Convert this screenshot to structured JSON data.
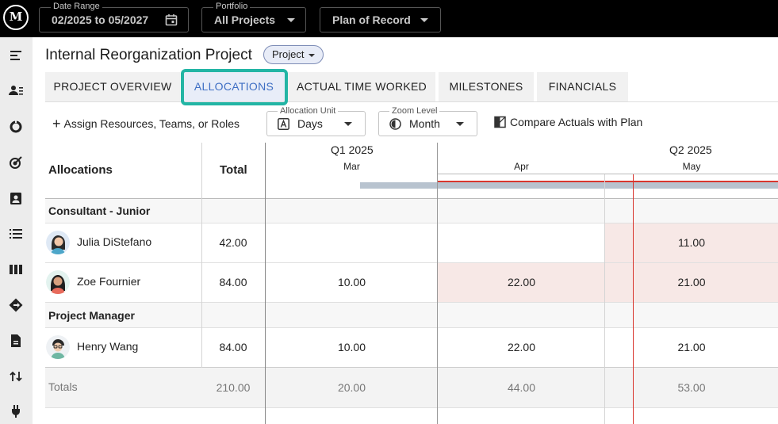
{
  "topbar": {
    "logo_text": "M",
    "date_range": {
      "label": "Date Range",
      "value": "02/2025 to 05/2027"
    },
    "portfolio": {
      "label": "Portfolio",
      "value": "All Projects"
    },
    "plan": {
      "value": "Plan of Record"
    }
  },
  "rail": {
    "icons": [
      "menu-collapse-icon",
      "people-list-icon",
      "donut-chart-icon",
      "target-icon",
      "contact-badge-icon",
      "list-icon",
      "columns-icon",
      "roadmap-icon",
      "document-icon",
      "transfer-arrows-icon",
      "plug-icon"
    ]
  },
  "project": {
    "title": "Internal Reorganization Project",
    "type_chip": "Project"
  },
  "tabs": [
    {
      "label": "PROJECT OVERVIEW"
    },
    {
      "label": "ALLOCATIONS",
      "active": true
    },
    {
      "label": "ACTUAL TIME WORKED"
    },
    {
      "label": "MILESTONES"
    },
    {
      "label": "FINANCIALS"
    }
  ],
  "toolbar": {
    "assign_label": "Assign Resources, Teams, or Roles",
    "allocation_unit": {
      "label": "Allocation Unit",
      "value": "Days"
    },
    "zoom_level": {
      "label": "Zoom Level",
      "value": "Month"
    },
    "compare_label": "Compare Actuals with Plan"
  },
  "grid": {
    "col_allocations": "Allocations",
    "col_total": "Total",
    "quarters": [
      "Q1 2025",
      "Q2 2025"
    ],
    "months": [
      "Mar",
      "Apr",
      "May"
    ],
    "groups": [
      {
        "name": "Consultant - Junior",
        "rows": [
          {
            "name": "Julia DiStefano",
            "total": "42.00",
            "values": [
              "",
              "",
              "11.00"
            ]
          },
          {
            "name": "Zoe Fournier",
            "total": "84.00",
            "values": [
              "10.00",
              "22.00",
              "21.00"
            ]
          }
        ]
      },
      {
        "name": "Project Manager",
        "rows": [
          {
            "name": "Henry Wang",
            "total": "84.00",
            "values": [
              "10.00",
              "22.00",
              "21.00"
            ]
          }
        ]
      }
    ],
    "totals": {
      "label": "Totals",
      "total": "210.00",
      "values": [
        "20.00",
        "44.00",
        "53.00"
      ]
    }
  },
  "colors": {
    "accent": "#3f6fc4",
    "tab_highlight": "#22b5a5",
    "over_allocation": "#f7e8e6",
    "today_line": "#d9372f",
    "timeline_bar": "#b8c3cf"
  }
}
